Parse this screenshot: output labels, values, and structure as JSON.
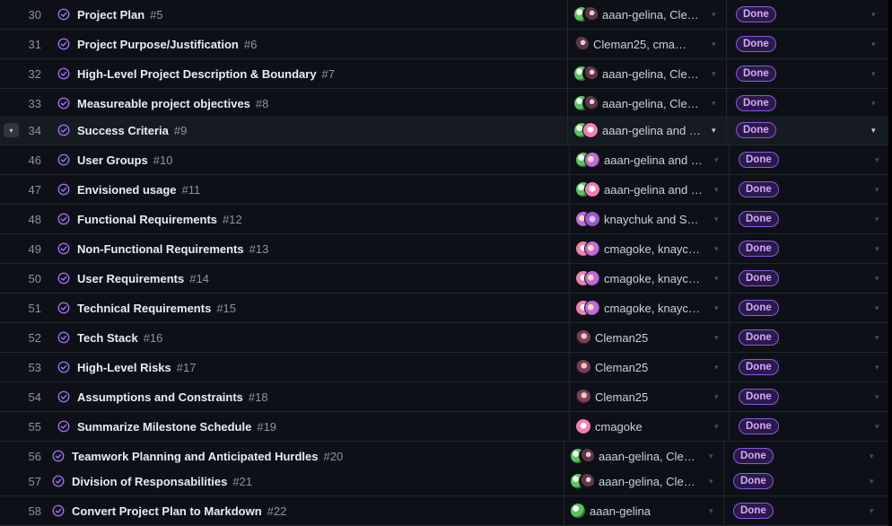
{
  "colors": {
    "status_done": "#8957e5",
    "closed_icon": "#a371f7"
  },
  "icons": {
    "row_status": "issue-closed-icon",
    "dropdown": "caret-down-icon",
    "expand": "chevron-down-icon"
  },
  "rows": [
    {
      "num": "30",
      "title": "Project Plan",
      "issue": "#5",
      "assignees": "aaan-gelina, Clem…",
      "avatars": [
        "aan",
        "cle"
      ],
      "status": "Done"
    },
    {
      "num": "31",
      "title": "Project Purpose/Justification",
      "issue": "#6",
      "assignees": "Cleman25, cmago…",
      "avatars": [
        "cle"
      ],
      "status": "Done"
    },
    {
      "num": "32",
      "title": "High-Level Project Description & Boundary",
      "issue": "#7",
      "assignees": "aaan-gelina, Clem…",
      "avatars": [
        "aan",
        "cle"
      ],
      "status": "Done"
    },
    {
      "num": "33",
      "title": "Measureable project objectives",
      "issue": "#8",
      "assignees": "aaan-gelina, Clem…",
      "avatars": [
        "aan",
        "cle"
      ],
      "status": "Done"
    },
    {
      "num": "34",
      "title": "Success Criteria",
      "issue": "#9",
      "assignees": "aaan-gelina and c…",
      "avatars": [
        "aan",
        "cma"
      ],
      "status": "Done",
      "selected": true
    },
    {
      "num": "46",
      "title": "User Groups",
      "issue": "#10",
      "assignees": "aaan-gelina and k…",
      "avatars": [
        "aan",
        "kna"
      ],
      "status": "Done"
    },
    {
      "num": "47",
      "title": "Envisioned usage",
      "issue": "#11",
      "assignees": "aaan-gelina and c…",
      "avatars": [
        "aan",
        "cma"
      ],
      "status": "Done"
    },
    {
      "num": "48",
      "title": "Functional Requirements",
      "issue": "#12",
      "assignees": "knaychuk and Sum…",
      "avatars": [
        "kna",
        "sum"
      ],
      "status": "Done"
    },
    {
      "num": "49",
      "title": "Non-Functional Requirements",
      "issue": "#13",
      "assignees": "cmagoke, knaych…",
      "avatars": [
        "cma",
        "kna"
      ],
      "status": "Done"
    },
    {
      "num": "50",
      "title": "User Requirements",
      "issue": "#14",
      "assignees": "cmagoke, knaych…",
      "avatars": [
        "cma",
        "kna"
      ],
      "status": "Done"
    },
    {
      "num": "51",
      "title": "Technical Requirements",
      "issue": "#15",
      "assignees": "cmagoke, knaych…",
      "avatars": [
        "cma",
        "kna"
      ],
      "status": "Done"
    },
    {
      "num": "52",
      "title": "Tech Stack",
      "issue": "#16",
      "assignees": "Cleman25",
      "avatars": [
        "cleman"
      ],
      "status": "Done"
    },
    {
      "num": "53",
      "title": "High-Level Risks",
      "issue": "#17",
      "assignees": "Cleman25",
      "avatars": [
        "cleman"
      ],
      "status": "Done"
    },
    {
      "num": "54",
      "title": "Assumptions and Constraints",
      "issue": "#18",
      "assignees": "Cleman25",
      "avatars": [
        "cleman"
      ],
      "status": "Done"
    },
    {
      "num": "55",
      "title": "Summarize Milestone Schedule",
      "issue": "#19",
      "assignees": "cmagoke",
      "avatars": [
        "cma"
      ],
      "status": "Done"
    },
    {
      "num": "56",
      "title": "Teamwork Planning and Anticipated Hurdles",
      "issue": "#20",
      "assignees": "aaan-gelina, Clem…",
      "avatars": [
        "aan",
        "cle"
      ],
      "status": "Done"
    },
    {
      "num": "57",
      "title": "Division of Responsabilities",
      "issue": "#21",
      "assignees": "aaan-gelina, Clem…",
      "avatars": [
        "aan",
        "cle"
      ],
      "status": "Done"
    },
    {
      "num": "58",
      "title": "Convert Project Plan to Markdown",
      "issue": "#22",
      "assignees": "aaan-gelina",
      "avatars": [
        "aan"
      ],
      "status": "Done"
    }
  ]
}
